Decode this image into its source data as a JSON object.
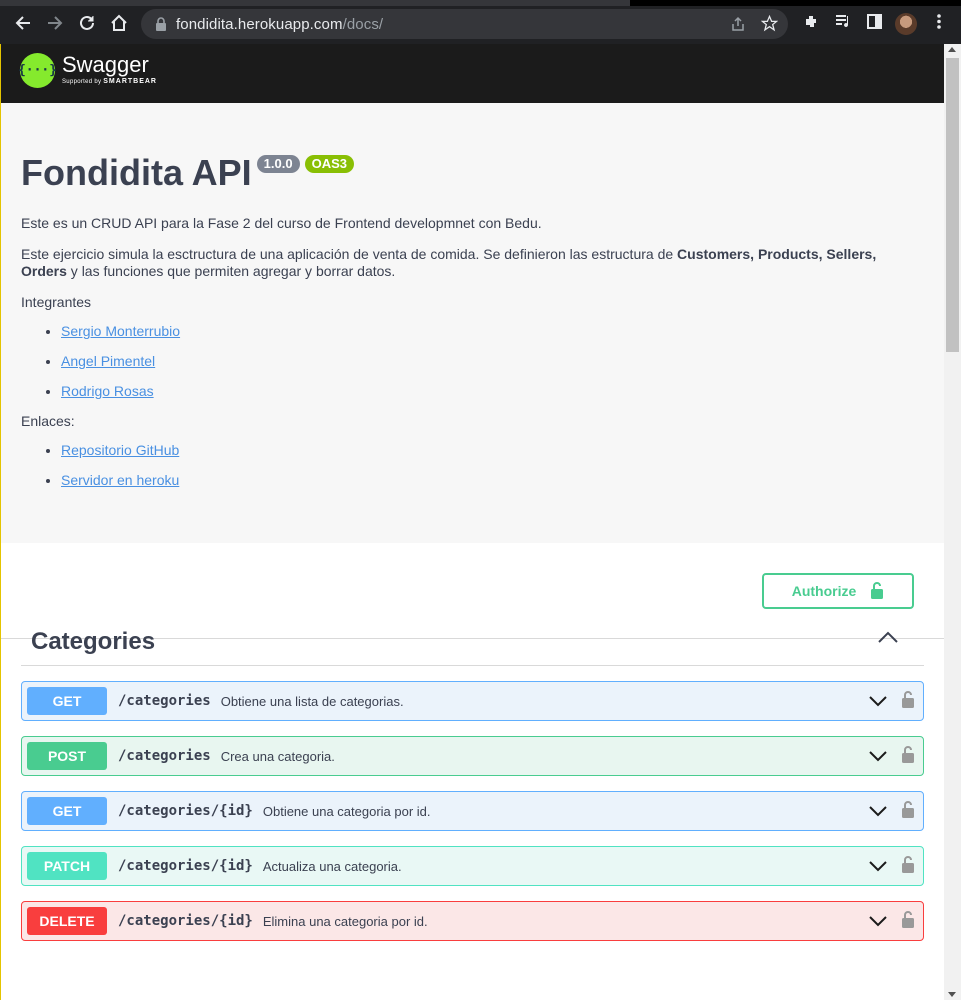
{
  "browser": {
    "url_host": "fondidita.herokuapp.com",
    "url_path": "/docs/"
  },
  "swagger": {
    "logo_name": "Swagger",
    "logo_supported": "Supported by",
    "logo_brand": "SMARTBEAR"
  },
  "info": {
    "title": "Fondidita API",
    "version": "1.0.0",
    "oas": "OAS3",
    "p1": "Este es un CRUD API para la Fase 2 del curso de Frontend developmnet con Bedu.",
    "p2_a": "Este ejercicio simula la esctructura de una aplicación de venta de comida. Se definieron las estructura de ",
    "p2_customers": "Customers",
    "p2_sep1": ", ",
    "p2_products": "Products",
    "p2_sep2": ", ",
    "p2_sellers": "Sellers",
    "p2_sep3": ", ",
    "p2_orders": "Orders",
    "p2_b": " y las funciones que permiten agregar y borrar datos.",
    "members_heading": "Integrantes",
    "members": [
      "Sergio Monterrubio",
      "Angel Pimentel",
      "Rodrigo Rosas"
    ],
    "links_heading": "Enlaces:",
    "links": [
      "Repositorio GitHub",
      "Servidor en heroku"
    ]
  },
  "authorize": {
    "label": "Authorize"
  },
  "section": {
    "title": "Categories",
    "ops": [
      {
        "method": "GET",
        "path": "/categories",
        "summary": "Obtiene una lista de categorias."
      },
      {
        "method": "POST",
        "path": "/categories",
        "summary": "Crea una categoria."
      },
      {
        "method": "GET",
        "path": "/categories/{id}",
        "summary": "Obtiene una categoria por id."
      },
      {
        "method": "PATCH",
        "path": "/categories/{id}",
        "summary": "Actualiza una categoria."
      },
      {
        "method": "DELETE",
        "path": "/categories/{id}",
        "summary": "Elimina una categoria por id."
      }
    ]
  },
  "colors": {
    "get": "#61affe",
    "post": "#49cc90",
    "patch": "#50e3c2",
    "delete": "#f93e3e",
    "swagger_green": "#85ea2d"
  }
}
